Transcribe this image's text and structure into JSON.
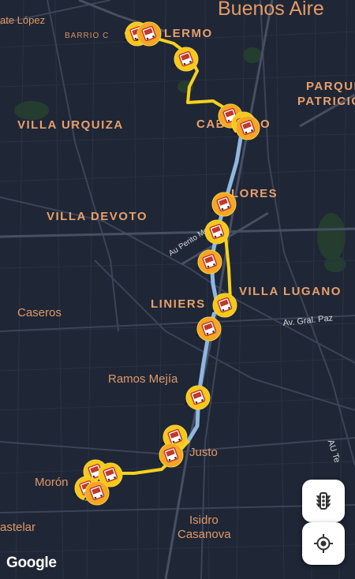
{
  "labels": {
    "buenos_aires": "Buenos Aire",
    "ate_lopez": "ate López",
    "barrio": "BARRIO C",
    "palermo": "LERMO",
    "parque": "PARQUE",
    "patricios": "PATRICIO",
    "villa_urquiza": "VILLA URQUIZA",
    "caballito": "CAB",
    "caballito_end": "O",
    "villa_devoto": "VILLA DEVOTO",
    "flores": "LORES",
    "peritomoreno": "Au Perito Moreno",
    "liniers": "LINIERS",
    "villa_lugano": "VILLA LUGANO",
    "caseros": "Caseros",
    "gral_paz": "Av. Gral. Paz",
    "ramos_mejia": "Ramos Mejía",
    "justo": "Justo",
    "moron": "Morón",
    "castelar": "astelar",
    "isidro": "Isidro",
    "casanova": "Casanova",
    "au_te": "AU Te"
  },
  "attribution": "Google",
  "controls": {
    "traffic_icon": "traffic-light-icon",
    "location_icon": "my-location-icon"
  },
  "colors": {
    "route_yellow": "#f7d21c",
    "route_blue": "#8fb8e0",
    "marker_orange": "#f6a623",
    "marker_yellow": "#f7c81a"
  }
}
